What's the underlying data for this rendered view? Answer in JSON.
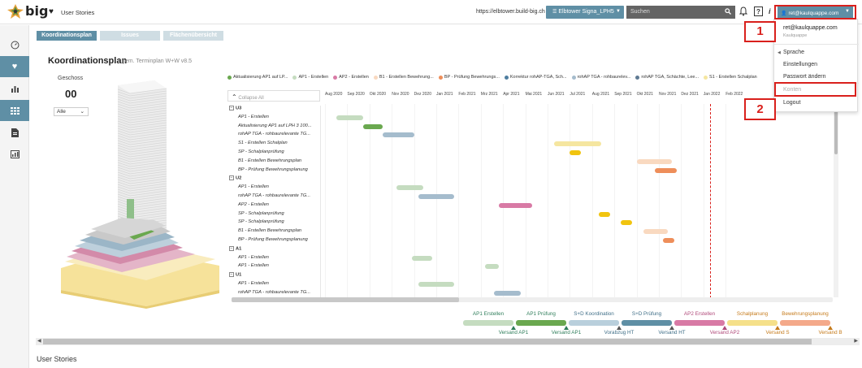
{
  "header": {
    "logo_text": "big",
    "section_title": "User Stories",
    "url": "https://elbtower.build-big.ch",
    "project": "Elbtower Signa_LPH5",
    "search_placeholder": "Suchen",
    "help_label": "?",
    "info_label": "i",
    "user_email": "ret@kaulquappe.com"
  },
  "markers": [
    "1",
    "2"
  ],
  "tabs": [
    "Koordinationsplan",
    "Issues",
    "Flächenübersicht"
  ],
  "title": "Koordinationsplan",
  "subtitle": "gem. Terminplan W+W v8.5",
  "geschoss": {
    "label": "Geschoss",
    "value": "00",
    "filter": "Alle"
  },
  "legend": [
    {
      "label": "Aktualisierung AP1 auf LP...",
      "color": "#6aa84f"
    },
    {
      "label": "AP1 - Erstellen",
      "color": "#c5dcc0"
    },
    {
      "label": "AP2 - Erstellen",
      "color": "#d87aa5"
    },
    {
      "label": "B1 - Erstellen Bewehrung...",
      "color": "#f9d9c0"
    },
    {
      "label": "BP - Prüfung Bewehrungs...",
      "color": "#ee8e5a"
    },
    {
      "label": "Korrektur rohAP-TGA, Sch...",
      "color": "#4f7ea0"
    },
    {
      "label": "rohAP TGA - rohbaurelev...",
      "color": "#a5bccd"
    },
    {
      "label": "rohAP TGA, Schächte, Lee...",
      "color": "#5f7a93"
    },
    {
      "label": "S1 - Erstellen Schalplan",
      "color": "#f5e6a0"
    }
  ],
  "collapse_label": "Collapse All",
  "months": [
    "Aug 2020",
    "Sep 2020",
    "Okt 2020",
    "Nov 2020",
    "Dez 2020",
    "Jan 2021",
    "Feb 2021",
    "Mrz 2021",
    "Apr 2021",
    "Mai 2021",
    "Jun 2021",
    "Jul 2021",
    "Aug 2021",
    "Sep 2021",
    "Okt 2021",
    "Nov 2021",
    "Dez 2021",
    "Jan 2022",
    "Feb 2022"
  ],
  "gantt_rows": [
    {
      "type": "group",
      "label": "U3"
    },
    {
      "type": "task",
      "label": "AP1 - Erstellen"
    },
    {
      "type": "task",
      "label": "Aktualisierung AP1 auf LPH 3 100..."
    },
    {
      "type": "task",
      "label": "rohAP TGA - rohbaurelevante TG..."
    },
    {
      "type": "task",
      "label": "S1 - Erstellen Schalplan"
    },
    {
      "type": "task",
      "label": "SP - Schalplanprüfung"
    },
    {
      "type": "task",
      "label": "B1 - Erstellen Bewehrungsplan"
    },
    {
      "type": "task",
      "label": "BP - Prüfung Bewehrungsplanung"
    },
    {
      "type": "group",
      "label": "U2"
    },
    {
      "type": "task",
      "label": "AP1 - Erstellen"
    },
    {
      "type": "task",
      "label": "rohAP TGA - rohbaurelevante TG..."
    },
    {
      "type": "task",
      "label": "AP2 - Erstellen"
    },
    {
      "type": "task",
      "label": "SP - Schalplanprüfung"
    },
    {
      "type": "task",
      "label": "SP - Schalplanprüfung"
    },
    {
      "type": "task",
      "label": "B1 - Erstellen Bewehrungsplan"
    },
    {
      "type": "task",
      "label": "BP - Prüfung Bewehrungsplanung"
    },
    {
      "type": "group",
      "label": "A1"
    },
    {
      "type": "task",
      "label": "AP1 - Erstellen"
    },
    {
      "type": "task",
      "label": "AP1 - Erstellen"
    },
    {
      "type": "group",
      "label": "U1"
    },
    {
      "type": "task",
      "label": "AP1 - Erstellen"
    },
    {
      "type": "task",
      "label": "rohAP TGA - rohbaurelevante TG..."
    }
  ],
  "gantt_bars": [
    {
      "row": 1,
      "start": 0.5,
      "end": 1.7,
      "color": "#c5dcc0"
    },
    {
      "row": 2,
      "start": 1.7,
      "end": 2.6,
      "color": "#6aa84f"
    },
    {
      "row": 3,
      "start": 2.6,
      "end": 4.0,
      "color": "#a5bccd"
    },
    {
      "row": 4,
      "start": 10.3,
      "end": 12.4,
      "color": "#f5e6a0"
    },
    {
      "row": 5,
      "start": 11.0,
      "end": 11.5,
      "color": "#f1c40f"
    },
    {
      "row": 6,
      "start": 14.0,
      "end": 15.6,
      "color": "#f9d9c0"
    },
    {
      "row": 7,
      "start": 14.8,
      "end": 15.8,
      "color": "#ee8e5a"
    },
    {
      "row": 9,
      "start": 3.2,
      "end": 4.4,
      "color": "#c5dcc0"
    },
    {
      "row": 10,
      "start": 4.2,
      "end": 5.8,
      "color": "#a5bccd"
    },
    {
      "row": 11,
      "start": 7.8,
      "end": 9.3,
      "color": "#d87aa5"
    },
    {
      "row": 12,
      "start": 12.3,
      "end": 12.8,
      "color": "#f1c40f"
    },
    {
      "row": 13,
      "start": 13.3,
      "end": 13.8,
      "color": "#f1c40f"
    },
    {
      "row": 14,
      "start": 14.3,
      "end": 15.4,
      "color": "#f9d9c0"
    },
    {
      "row": 15,
      "start": 15.2,
      "end": 15.7,
      "color": "#ee8e5a"
    },
    {
      "row": 17,
      "start": 3.9,
      "end": 4.8,
      "color": "#c5dcc0"
    },
    {
      "row": 18,
      "start": 7.2,
      "end": 7.8,
      "color": "#c5dcc0"
    },
    {
      "row": 20,
      "start": 4.2,
      "end": 5.8,
      "color": "#c5dcc0"
    },
    {
      "row": 21,
      "start": 7.6,
      "end": 8.8,
      "color": "#a5bccd"
    }
  ],
  "today_month": 17.3,
  "phases": [
    {
      "top": "AP1 Erstellen",
      "bottom": "Versand AP1",
      "color": "#c5dcc0"
    },
    {
      "top": "AP1 Prüfung",
      "bottom": "Versand AP1",
      "color": "#6aa84f"
    },
    {
      "top": "S+D Koordination",
      "bottom": "Vorabzug HT",
      "color": "#b9cfdc"
    },
    {
      "top": "S+D Prüfung",
      "bottom": "Versand HT",
      "color": "#5f8fa5"
    },
    {
      "top": "AP2 Erstellen",
      "bottom": "Versand AP2",
      "color": "#d87aa5"
    },
    {
      "top": "Schalplanung",
      "bottom": "Versand S",
      "color": "#f5e08a"
    },
    {
      "top": "Bewehrungsplanung",
      "bottom": "Versand B",
      "color": "#f4a98a"
    }
  ],
  "phase_colors": {
    "green": "#2e7d5a",
    "blue": "#3f6e87",
    "pink": "#b04a7a",
    "orange": "#c57a1a"
  },
  "bottom_title": "User Stories",
  "dropdown": {
    "email": "ret@kaulquappe.com",
    "company": "Kaulquappe",
    "items": [
      "Sprache",
      "Einstellungen",
      "Passwort ändern",
      "Konten",
      "Logout"
    ]
  },
  "accent": "#5f8fa5"
}
